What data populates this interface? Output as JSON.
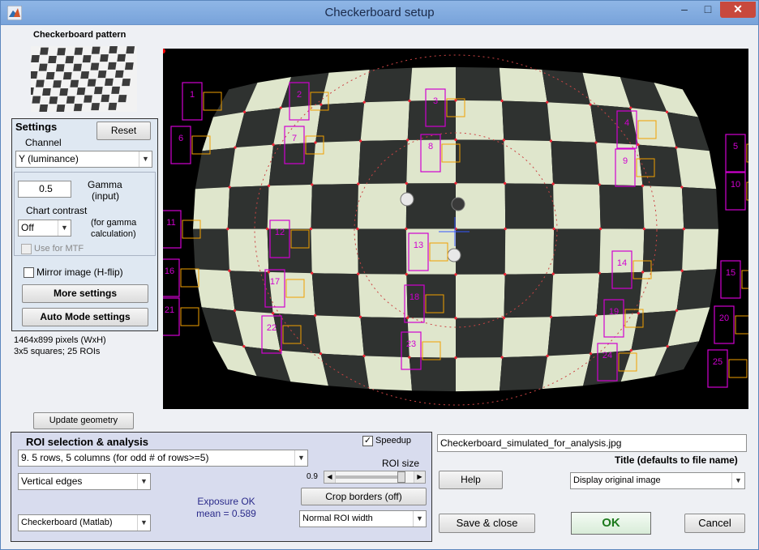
{
  "window": {
    "title": "Checkerboard setup",
    "minimize": "–",
    "maximize": "□",
    "close": "✕"
  },
  "pattern": {
    "label": "Checkerboard pattern"
  },
  "settings": {
    "heading": "Settings",
    "reset": "Reset",
    "channel_label": "Channel",
    "channel_value": "Y (luminance)",
    "gamma_value": "0.5",
    "gamma_label_1": "Gamma",
    "gamma_label_2": "(input)",
    "chart_contrast_label": "Chart contrast",
    "chart_contrast_value": "Off",
    "gamma_calc_1": "(for gamma",
    "gamma_calc_2": "calculation)",
    "use_for_mtf": "Use for MTF",
    "mirror": "Mirror image (H-flip)",
    "more_settings": "More settings",
    "auto_mode": "Auto Mode settings"
  },
  "info": {
    "pixels": "1464x899 pixels (WxH)",
    "squares": "3x5 squares;   25 ROIs"
  },
  "update_geometry": "Update geometry",
  "roi": {
    "heading": "ROI selection & analysis",
    "speedup": "Speedup",
    "speedup_checked": true,
    "rows_value": "9.  5 rows, 5 columns (for odd # of rows>=5)",
    "edges_value": "Vertical edges",
    "method_value": "Checkerboard (Matlab)",
    "exposure_1": "Exposure OK",
    "exposure_2": "mean = 0.589",
    "roi_size_label": "ROI size",
    "roi_size_value": "0.9",
    "roi_size_fraction": 0.88,
    "crop_borders": "Crop borders  (off)",
    "roi_width_value": "Normal ROI width"
  },
  "right": {
    "filename": "Checkerboard_simulated_for_analysis.jpg",
    "title_label": "Title (defaults to file name)",
    "help": "Help",
    "display_value": "Display original image",
    "save_close": "Save & close",
    "ok": "OK",
    "cancel": "Cancel"
  },
  "rois": [
    "1",
    "2",
    "3",
    "4",
    "5",
    "6",
    "7",
    "8",
    "9",
    "10",
    "11",
    "12",
    "13",
    "14",
    "15",
    "16",
    "17",
    "18",
    "19",
    "20",
    "21",
    "22",
    "23",
    "24",
    "25"
  ],
  "colors": {
    "roi_magenta": "#d000d0",
    "roi_orange": "#f0a000",
    "light_square": "#dfe6cc",
    "dark_square": "#2f3230"
  }
}
